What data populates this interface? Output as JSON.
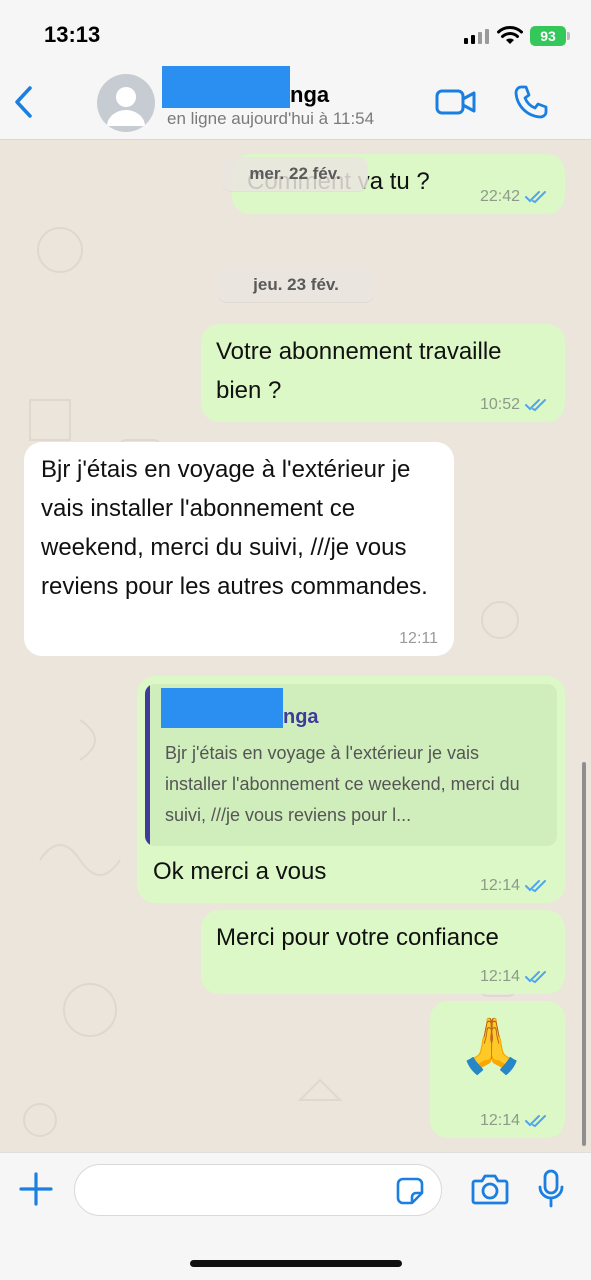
{
  "status_bar": {
    "time": "13:13",
    "battery": "93"
  },
  "header": {
    "contact_name_visible": "nga",
    "contact_status": "en ligne aujourd'hui à 11:54"
  },
  "messages": [
    {
      "text": "Comment va tu ?",
      "time": "22:42",
      "direction": "out"
    },
    {
      "text": "Votre abonnement travaille bien ?",
      "time": "10:52",
      "direction": "out"
    },
    {
      "text": "Bjr j'étais en voyage à l'extérieur je vais installer l'abonnement ce weekend, merci du suivi, ///je vous reviens pour les autres commandes.",
      "time": "12:11",
      "direction": "in"
    },
    {
      "text": "Ok merci a vous",
      "time": "12:14",
      "direction": "out",
      "quote": {
        "name_visible": "nga",
        "text": "Bjr j'étais en voyage à l'extérieur je vais installer l'abonnement ce weekend, merci du suivi, ///je vous reviens pour l..."
      }
    },
    {
      "text": "Merci pour votre confiance",
      "time": "12:14",
      "direction": "out"
    },
    {
      "text": "🙏",
      "time": "12:14",
      "direction": "out"
    }
  ],
  "date_separators": [
    "mer. 22 fév.",
    "jeu. 23 fév."
  ],
  "input": {
    "value": "",
    "placeholder": ""
  },
  "colors": {
    "accent": "#1a7fe0",
    "outgoing_bubble": "#dbf8c6",
    "incoming_bubble": "#ffffff",
    "read_ticks": "#4fa6ee",
    "quote_accent": "#3f3a9c"
  },
  "icons": [
    "back-chevron-icon",
    "avatar-icon",
    "video-call-icon",
    "phone-icon",
    "double-check-icon",
    "plus-icon",
    "sticker-icon",
    "camera-icon",
    "microphone-icon"
  ]
}
